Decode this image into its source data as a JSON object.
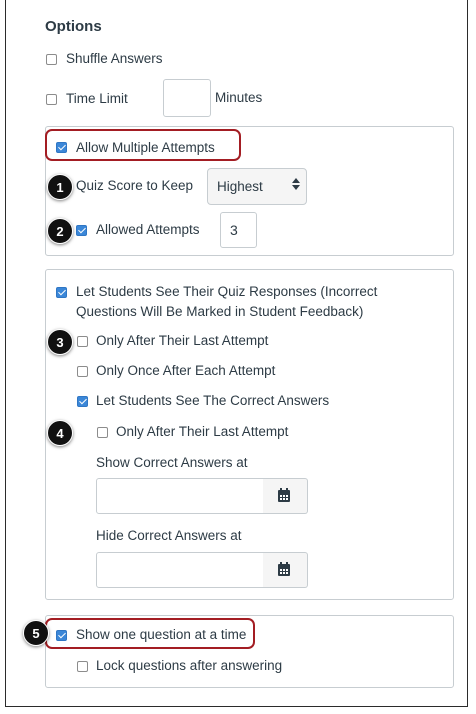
{
  "options": {
    "heading": "Options",
    "shuffle_answers": {
      "label": "Shuffle Answers",
      "checked": false
    },
    "time_limit": {
      "label": "Time Limit",
      "value": "",
      "unit": "Minutes",
      "checked": false
    }
  },
  "attempts": {
    "allow_multiple": {
      "label": "Allow Multiple Attempts",
      "checked": true
    },
    "score_to_keep": {
      "label": "Quiz Score to Keep",
      "selected": "Highest"
    },
    "allowed_attempts": {
      "label": "Allowed Attempts",
      "value": "3",
      "checked": true
    }
  },
  "responses": {
    "see_responses_line1": "Let Students See Their Quiz Responses (Incorrect",
    "see_responses_line2": "Questions Will Be Marked in Student Feedback)",
    "only_after_last": "Only After Their Last Attempt",
    "only_once_each": "Only Once After Each Attempt",
    "see_correct": "Let Students See The Correct Answers",
    "correct_only_after_last": "Only After Their Last Attempt",
    "show_correct_at": {
      "label": "Show Correct Answers at",
      "value": ""
    },
    "hide_correct_at": {
      "label": "Hide Correct Answers at",
      "value": ""
    }
  },
  "questions": {
    "one_at_a_time": {
      "label": "Show one question at a time",
      "checked": true
    },
    "lock_after": {
      "label": "Lock questions after answering",
      "checked": false
    }
  },
  "badges": [
    "1",
    "2",
    "3",
    "4",
    "5"
  ],
  "colors": {
    "accent": "#3b87d8",
    "highlight": "#a31d23",
    "badge": "#111111"
  }
}
